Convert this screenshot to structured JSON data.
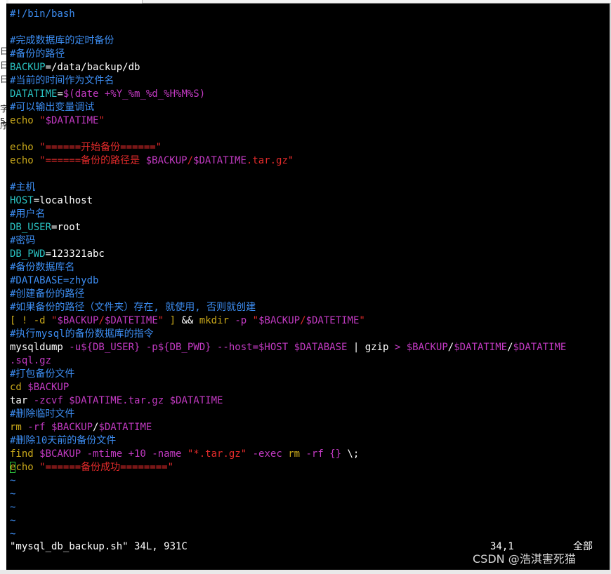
{
  "left_strip": {
    "fragments": [
      "日",
      "日",
      "日",
      "字",
      "5",
      "序"
    ]
  },
  "editor": {
    "lines": [
      [
        {
          "t": "#!/bin/bash",
          "c": "cm"
        }
      ],
      [],
      [
        {
          "t": "#完成数据库的定时备份",
          "c": "cm"
        }
      ],
      [
        {
          "t": "#备份的路径",
          "c": "cm"
        }
      ],
      [
        {
          "t": "BACKUP",
          "c": "var"
        },
        {
          "t": "=/data/backup/db",
          "c": "tx"
        }
      ],
      [
        {
          "t": "#当前的时间作为文件名",
          "c": "cm"
        }
      ],
      [
        {
          "t": "DATATIME",
          "c": "var"
        },
        {
          "t": "=",
          "c": "tx"
        },
        {
          "t": "$(date +%Y_%m_%d_%H%M%S)",
          "c": "op"
        }
      ],
      [
        {
          "t": "#可以输出变量调试",
          "c": "cm"
        }
      ],
      [
        {
          "t": "echo",
          "c": "kw"
        },
        {
          "t": " ",
          "c": "tx"
        },
        {
          "t": "\"",
          "c": "st"
        },
        {
          "t": "$DATATIME",
          "c": "op"
        },
        {
          "t": "\"",
          "c": "st"
        }
      ],
      [],
      [
        {
          "t": "echo",
          "c": "kw"
        },
        {
          "t": " ",
          "c": "tx"
        },
        {
          "t": "\"======开始备份======\"",
          "c": "st"
        }
      ],
      [
        {
          "t": "echo",
          "c": "kw"
        },
        {
          "t": " ",
          "c": "tx"
        },
        {
          "t": "\"======备份的路径是 ",
          "c": "st"
        },
        {
          "t": "$BACKUP",
          "c": "op"
        },
        {
          "t": "/",
          "c": "st"
        },
        {
          "t": "$DATATIME",
          "c": "op"
        },
        {
          "t": ".tar.gz\"",
          "c": "st"
        }
      ],
      [],
      [
        {
          "t": "#主机",
          "c": "cm"
        }
      ],
      [
        {
          "t": "HOST",
          "c": "var"
        },
        {
          "t": "=localhost",
          "c": "tx"
        }
      ],
      [
        {
          "t": "#用户名",
          "c": "cm"
        }
      ],
      [
        {
          "t": "DB_USER",
          "c": "var"
        },
        {
          "t": "=root",
          "c": "tx"
        }
      ],
      [
        {
          "t": "#密码",
          "c": "cm"
        }
      ],
      [
        {
          "t": "DB_PWD",
          "c": "var"
        },
        {
          "t": "=123321abc",
          "c": "tx"
        }
      ],
      [
        {
          "t": "#备份数据库名",
          "c": "cm"
        }
      ],
      [
        {
          "t": "#DATABASE=zhydb",
          "c": "cm"
        }
      ],
      [
        {
          "t": "#创建备份的路径",
          "c": "cm"
        }
      ],
      [
        {
          "t": "#如果备份的路径（文件夹）存在, 就使用, 否则就创建",
          "c": "cm"
        }
      ],
      [
        {
          "t": "[ ! -d ",
          "c": "kw"
        },
        {
          "t": "\"",
          "c": "st"
        },
        {
          "t": "$BACKUP",
          "c": "op"
        },
        {
          "t": "/",
          "c": "st"
        },
        {
          "t": "$DATETIME",
          "c": "op"
        },
        {
          "t": "\"",
          "c": "st"
        },
        {
          "t": " ]",
          "c": "kw"
        },
        {
          "t": " && ",
          "c": "tx"
        },
        {
          "t": "mkdir",
          "c": "kw"
        },
        {
          "t": " -p ",
          "c": "op"
        },
        {
          "t": "\"",
          "c": "st"
        },
        {
          "t": "$BACKUP",
          "c": "op"
        },
        {
          "t": "/",
          "c": "st"
        },
        {
          "t": "$DATETIME",
          "c": "op"
        },
        {
          "t": "\"",
          "c": "st"
        }
      ],
      [
        {
          "t": "#执行mysql的备份数据库的指令",
          "c": "cm"
        }
      ],
      [
        {
          "t": "mysqldump",
          "c": "tx"
        },
        {
          "t": " -u${DB_USER} -p${DB_PWD} --host=$HOST $DATABASE",
          "c": "op"
        },
        {
          "t": " | ",
          "c": "tx"
        },
        {
          "t": "gzip",
          "c": "tx"
        },
        {
          "t": " > ",
          "c": "op"
        },
        {
          "t": "$BACKUP",
          "c": "op"
        },
        {
          "t": "/",
          "c": "tx"
        },
        {
          "t": "$DATATIME",
          "c": "op"
        },
        {
          "t": "/",
          "c": "tx"
        },
        {
          "t": "$DATATIME",
          "c": "op"
        }
      ],
      [
        {
          "t": ".sql.gz",
          "c": "op"
        }
      ],
      [
        {
          "t": "#打包备份文件",
          "c": "cm"
        }
      ],
      [
        {
          "t": "cd",
          "c": "kw"
        },
        {
          "t": " $BACKUP",
          "c": "op"
        }
      ],
      [
        {
          "t": "tar",
          "c": "tx"
        },
        {
          "t": " -zcvf $DATATIME.tar.gz $DATATIME",
          "c": "op"
        }
      ],
      [
        {
          "t": "#删除临时文件",
          "c": "cm"
        }
      ],
      [
        {
          "t": "rm",
          "c": "kw"
        },
        {
          "t": " -rf $BACKUP",
          "c": "op"
        },
        {
          "t": "/",
          "c": "tx"
        },
        {
          "t": "$DATATIME",
          "c": "op"
        }
      ],
      [
        {
          "t": "#删除10天前的备份文件",
          "c": "cm"
        }
      ],
      [
        {
          "t": "find",
          "c": "kw"
        },
        {
          "t": " $BCAKUP -mtime +10 -name ",
          "c": "op"
        },
        {
          "t": "\"*.tar.gz\"",
          "c": "st"
        },
        {
          "t": " -exec ",
          "c": "op"
        },
        {
          "t": "rm",
          "c": "kw"
        },
        {
          "t": " -rf ",
          "c": "op"
        },
        {
          "t": "{}",
          "c": "op"
        },
        {
          "t": " \\;",
          "c": "tx"
        }
      ],
      [
        {
          "t": "e",
          "c": "kw",
          "cursor": true
        },
        {
          "t": "cho",
          "c": "kw"
        },
        {
          "t": " ",
          "c": "tx"
        },
        {
          "t": "\"======备份成功========\"",
          "c": "st"
        }
      ],
      [
        {
          "t": "~",
          "c": "tl"
        }
      ],
      [
        {
          "t": "~",
          "c": "tl"
        }
      ],
      [
        {
          "t": "~",
          "c": "tl"
        }
      ],
      [
        {
          "t": "~",
          "c": "tl"
        }
      ],
      [
        {
          "t": "~",
          "c": "tl"
        }
      ]
    ]
  },
  "status_line": {
    "file_info": "\"mysql_db_backup.sh\" 34L, 931C",
    "position": "34,1",
    "scroll": "全部"
  },
  "watermark": "CSDN @浩淇害死猫",
  "colors": {
    "background": "#000000",
    "comment": "#3c8cf0",
    "variable": "#2ac2c2",
    "keyword": "#c9a81a",
    "string": "#e02a2a",
    "operator": "#c23ac2",
    "text": "#ffffff",
    "cursor": "#2ecc40"
  }
}
